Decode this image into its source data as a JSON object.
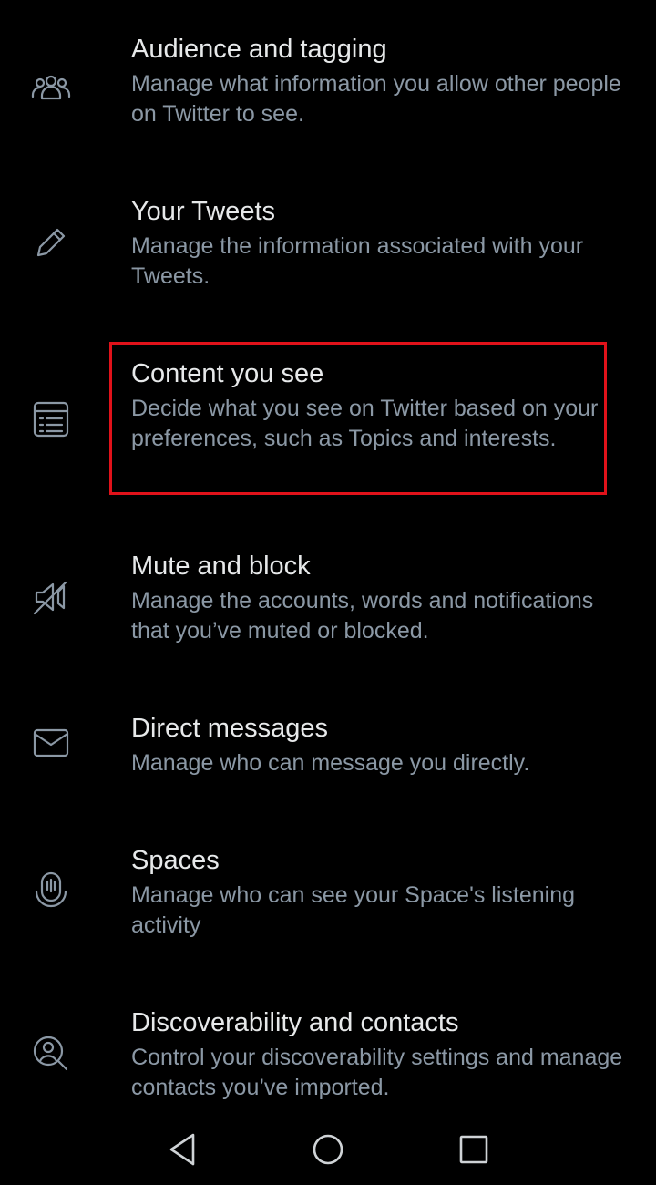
{
  "settings": {
    "items": [
      {
        "title": "Audience and tagging",
        "description": "Manage what information you allow other people on Twitter to see.",
        "icon": "people-icon"
      },
      {
        "title": "Your Tweets",
        "description": "Manage the information associated with your Tweets.",
        "icon": "pencil-icon"
      },
      {
        "title": "Content you see",
        "description": "Decide what you see on Twitter based on your preferences, such as Topics and interests.",
        "icon": "list-icon"
      },
      {
        "title": "Mute and block",
        "description": "Manage the accounts, words and notifications that you’ve muted or blocked.",
        "icon": "mute-icon"
      },
      {
        "title": "Direct messages",
        "description": "Manage who can message you directly.",
        "icon": "envelope-icon"
      },
      {
        "title": "Spaces",
        "description": "Manage who can see your Space's listening activity",
        "icon": "microphone-icon"
      },
      {
        "title": "Discoverability and contacts",
        "description": "Control your discoverability settings and manage contacts you’ve imported.",
        "icon": "search-person-icon"
      }
    ]
  },
  "highlight": {
    "color": "#e0121a",
    "target": "Content you see"
  },
  "navbar": {
    "icons": [
      "back-icon",
      "home-icon",
      "recents-icon"
    ]
  },
  "colors": {
    "background": "#000000",
    "title": "#e7e9ea",
    "description": "#8b98a5"
  }
}
